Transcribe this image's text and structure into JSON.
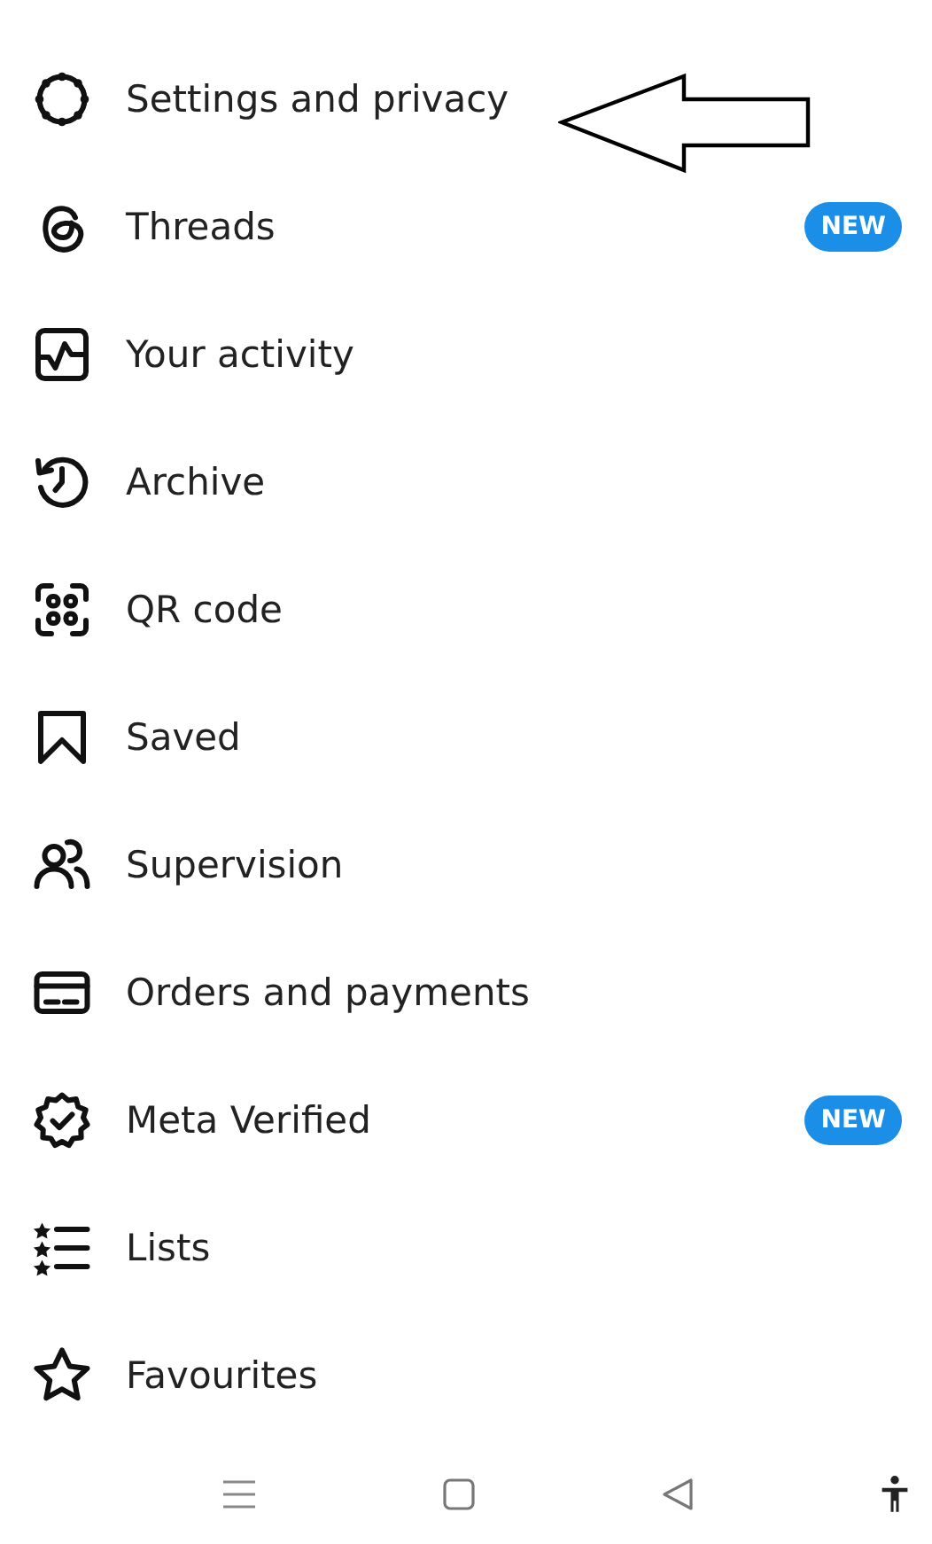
{
  "menu_items": [
    {
      "label": "Settings and privacy"
    },
    {
      "label": "Threads",
      "badge": "NEW"
    },
    {
      "label": "Your activity"
    },
    {
      "label": "Archive"
    },
    {
      "label": "QR code"
    },
    {
      "label": "Saved"
    },
    {
      "label": "Supervision"
    },
    {
      "label": "Orders and payments"
    },
    {
      "label": "Meta Verified",
      "badge": "NEW"
    },
    {
      "label": "Lists"
    },
    {
      "label": "Favourites"
    }
  ]
}
